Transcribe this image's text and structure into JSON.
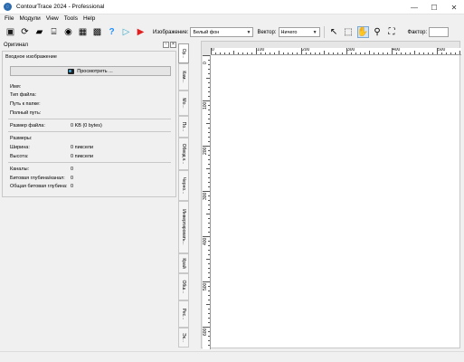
{
  "window": {
    "title": "ContourTrace 2024 - Professional",
    "minimize": "—",
    "maximize": "☐",
    "close": "✕"
  },
  "menu": [
    "File",
    "Модули",
    "View",
    "Tools",
    "Help"
  ],
  "toolbar": {
    "image_label": "Изображение:",
    "image_value": "Белый фон",
    "vector_label": "Вектор:",
    "vector_value": "Ничего",
    "factor_label": "Фактор:"
  },
  "left_panel": {
    "title": "Оригинал",
    "section_label": "Входное изображение",
    "preview_button": "Просмотреть ...",
    "fields": {
      "name": "Имя:",
      "file_type": "Тип файла:",
      "folder_path": "Путь к папке:",
      "full_path": "Полный путь:",
      "file_size_label": "Размер файла:",
      "file_size_value": "0 KB (0 bytes)",
      "dimensions": "Размеры:",
      "width_label": "Ширина:",
      "width_value": "0 пиксели",
      "height_label": "Высота:",
      "height_value": "0 пиксели",
      "channels_label": "Каналы:",
      "channels_value": "0",
      "bit_depth_channel_label": "Битовая глубина/канал:",
      "bit_depth_channel_value": "0",
      "total_bit_depth_label": "Общая битовая глубина:",
      "total_bit_depth_value": "0"
    }
  },
  "vertical_tabs": [
    "Ор...",
    "Кам...",
    "Мо...",
    "По...",
    "Обвод к...",
    "Черно...",
    "Инвертировать...",
    "Край",
    "Обш...",
    "Рес...",
    "Эк..."
  ],
  "ruler": {
    "top": [
      "0",
      "100",
      "200",
      "300",
      "400",
      "500"
    ],
    "left": [
      "0",
      "100",
      "200",
      "300",
      "400",
      "500",
      "600"
    ]
  }
}
